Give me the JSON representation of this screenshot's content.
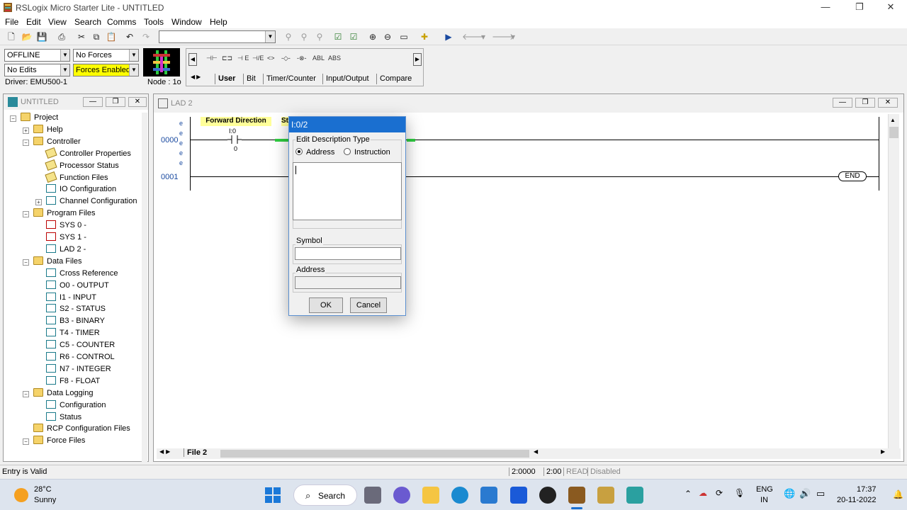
{
  "window": {
    "title": "RSLogix Micro Starter Lite - UNTITLED",
    "minimize": "—",
    "maximize": "❐",
    "close": "✕"
  },
  "menu": [
    "File",
    "Edit",
    "View",
    "Search",
    "Comms",
    "Tools",
    "Window",
    "Help"
  ],
  "status_panel": {
    "mode": "OFFLINE",
    "forces": "No Forces",
    "edits": "No Edits",
    "forces_enabled": "Forces Enabled",
    "driver": "Driver: EMU500-1",
    "node": "Node : 1o"
  },
  "palette": {
    "tools": [
      "⊣⊢",
      "⊏⊐",
      "⊣ E",
      "⊣/E",
      "<>",
      "-◇-",
      "-⊗-",
      "ABL",
      "ABS"
    ],
    "tabs": [
      "User",
      "Bit",
      "Timer/Counter",
      "Input/Output",
      "Compare"
    ]
  },
  "project": {
    "title": "UNTITLED",
    "items": [
      {
        "label": "Project",
        "level": 0,
        "icon": "folder",
        "expander": "-"
      },
      {
        "label": "Help",
        "level": 1,
        "icon": "folder",
        "expander": "+"
      },
      {
        "label": "Controller",
        "level": 1,
        "icon": "folder",
        "expander": "-"
      },
      {
        "label": "Controller Properties",
        "level": 2,
        "icon": "yellow"
      },
      {
        "label": "Processor Status",
        "level": 2,
        "icon": "yellow"
      },
      {
        "label": "Function Files",
        "level": 2,
        "icon": "yellow"
      },
      {
        "label": "IO Configuration",
        "level": 2,
        "icon": "io"
      },
      {
        "label": "Channel Configuration",
        "level": 2,
        "icon": "channel",
        "expander": "+"
      },
      {
        "label": "Program Files",
        "level": 1,
        "icon": "folder",
        "expander": "-"
      },
      {
        "label": "SYS 0 -",
        "level": 2,
        "icon": "red"
      },
      {
        "label": "SYS 1 -",
        "level": 2,
        "icon": "red"
      },
      {
        "label": "LAD 2 -",
        "level": 2,
        "icon": "lad"
      },
      {
        "label": "Data Files",
        "level": 1,
        "icon": "folder",
        "expander": "-"
      },
      {
        "label": "Cross Reference",
        "level": 2,
        "icon": "xref"
      },
      {
        "label": "O0 - OUTPUT",
        "level": 2,
        "icon": "file"
      },
      {
        "label": "I1 - INPUT",
        "level": 2,
        "icon": "file"
      },
      {
        "label": "S2 - STATUS",
        "level": 2,
        "icon": "file"
      },
      {
        "label": "B3 - BINARY",
        "level": 2,
        "icon": "file"
      },
      {
        "label": "T4 - TIMER",
        "level": 2,
        "icon": "file"
      },
      {
        "label": "C5 - COUNTER",
        "level": 2,
        "icon": "file"
      },
      {
        "label": "R6 - CONTROL",
        "level": 2,
        "icon": "file"
      },
      {
        "label": "N7 - INTEGER",
        "level": 2,
        "icon": "file"
      },
      {
        "label": "F8 - FLOAT",
        "level": 2,
        "icon": "file"
      },
      {
        "label": "Data Logging",
        "level": 1,
        "icon": "folder",
        "expander": "-"
      },
      {
        "label": "Configuration",
        "level": 2,
        "icon": "file"
      },
      {
        "label": "Status",
        "level": 2,
        "icon": "file"
      },
      {
        "label": "RCP Configuration Files",
        "level": 1,
        "icon": "folder"
      },
      {
        "label": "Force Files",
        "level": 1,
        "icon": "folder",
        "expander": "-"
      }
    ]
  },
  "ladder": {
    "title": "LAD 2",
    "rung0": "0000",
    "rung1": "0001",
    "desc": "Forward Direction",
    "desc2": "St",
    "addr": "I:0",
    "bit": "0",
    "end": "END",
    "file_tab": "File 2"
  },
  "dialog": {
    "title": "I:0/2",
    "group_label": "Edit Description Type",
    "opt_address": "Address",
    "opt_instruction": "Instruction",
    "description_value": "",
    "symbol_label": "Symbol",
    "symbol_value": "",
    "address_label": "Address",
    "address_value": "",
    "ok": "OK",
    "cancel": "Cancel"
  },
  "statusbar": {
    "message": "Entry is Valid",
    "pos1": "2:0000",
    "pos2": "2:00",
    "read": "READ",
    "disabled": "Disabled"
  },
  "taskbar": {
    "temp": "28°C",
    "weather": "Sunny",
    "search": "Search",
    "lang1": "ENG",
    "lang2": "IN",
    "time": "17:37",
    "date": "20-11-2022"
  },
  "colors": {
    "accent": "#1a6fd0",
    "forces_enabled_bg": "#ffff00",
    "desc_bg": "#ffff99",
    "rung_green": "#2ecc40"
  }
}
